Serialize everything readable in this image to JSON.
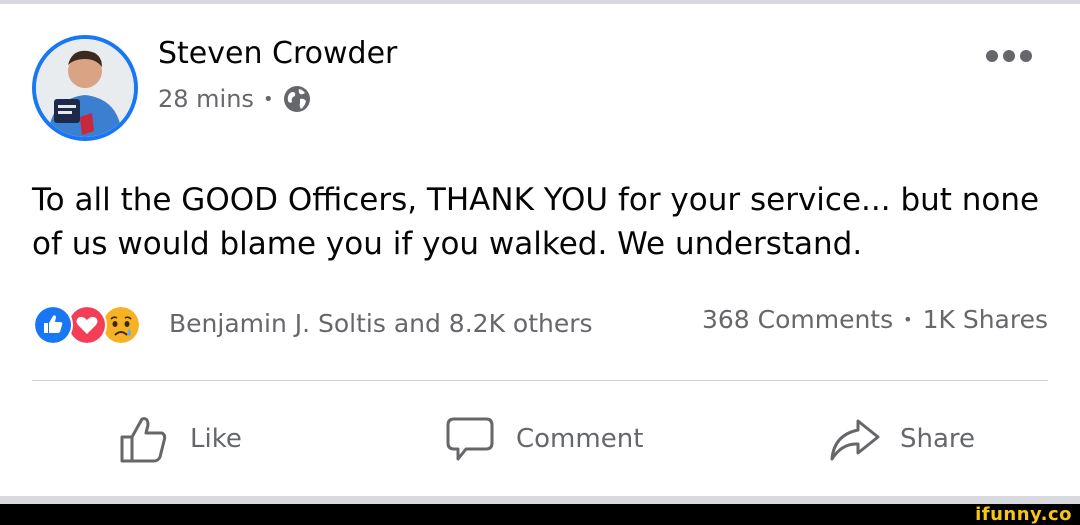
{
  "post": {
    "author": "Steven Crowder",
    "time": "28 mins",
    "separator": "•",
    "privacy_icon": "globe-icon",
    "text": "To all the GOOD Officers, THANK YOU for your service... but none of us would blame you if you walked. We understand."
  },
  "reactions": {
    "icons": [
      "like-reaction",
      "love-reaction",
      "sad-reaction"
    ],
    "summary": "Benjamin J. Soltis and 8.2K others"
  },
  "stats": {
    "comments": "368 Comments",
    "separator": "•",
    "shares": "1K Shares"
  },
  "actions": {
    "like": "Like",
    "comment": "Comment",
    "share": "Share"
  },
  "watermark": "ifunny.co",
  "colors": {
    "accent": "#1877f2",
    "love": "#f33e58",
    "sad": "#f7b125",
    "secondary_text": "#65676b"
  }
}
